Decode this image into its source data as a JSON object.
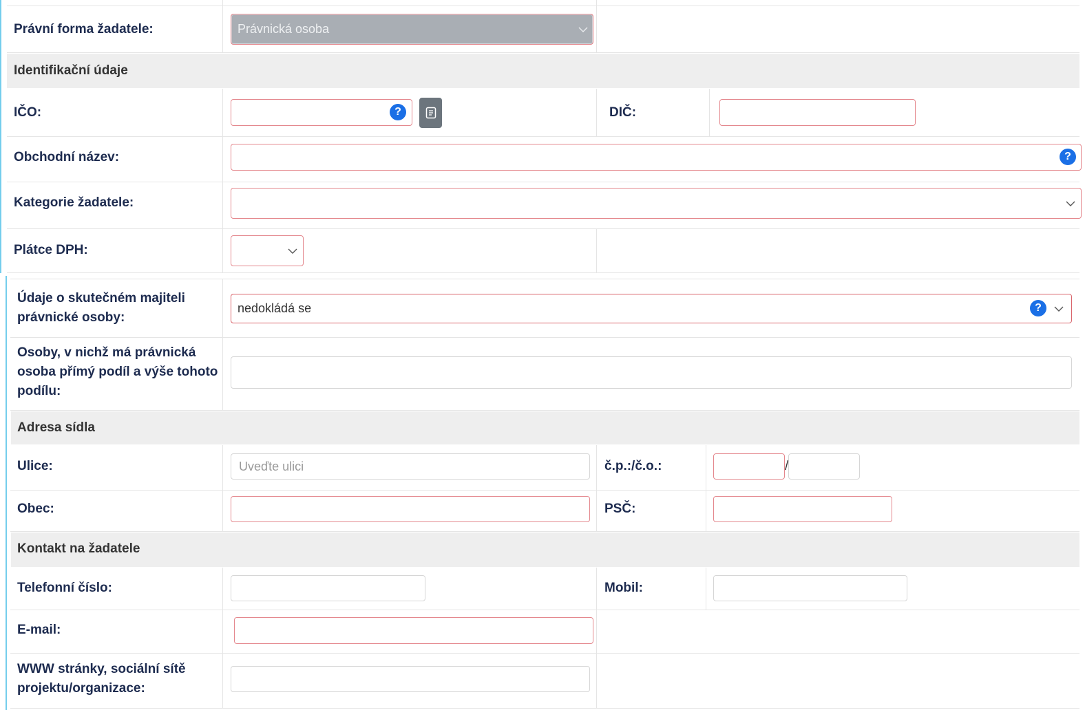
{
  "legal_form": {
    "label": "Právní forma žadatele:",
    "value": "Právnická osoba"
  },
  "identification": {
    "heading": "Identifikační údaje",
    "ico": {
      "label": "IČO:",
      "value": ""
    },
    "dic": {
      "label": "DIČ:",
      "value": ""
    },
    "business_name": {
      "label": "Obchodní název:",
      "value": ""
    },
    "category": {
      "label": "Kategorie žadatele:",
      "value": ""
    },
    "vat_payer": {
      "label": "Plátce DPH:",
      "value": ""
    }
  },
  "ownership": {
    "beneficial_owner": {
      "label_lines": [
        "Údaje o skutečném majiteli",
        "právnické osoby:"
      ],
      "value": "nedokládá se"
    },
    "direct_shares": {
      "label_lines": [
        "Osoby, v nichž má právnická",
        "osoba přímý podíl a výše tohoto",
        "podílu:"
      ],
      "value": ""
    }
  },
  "address": {
    "heading": "Adresa sídla",
    "street": {
      "label": "Ulice:",
      "value": "",
      "placeholder": "Uveďte ulici"
    },
    "house_number": {
      "label": "č.p.:/č.o.:",
      "cp_value": "",
      "separator": "/",
      "co_value": ""
    },
    "city": {
      "label": "Obec:",
      "value": ""
    },
    "postal_code": {
      "label": "PSČ:",
      "value": ""
    }
  },
  "contact": {
    "heading": "Kontakt na žadatele",
    "phone": {
      "label": "Telefonní číslo:",
      "value": ""
    },
    "mobile": {
      "label": "Mobil:",
      "value": ""
    },
    "email": {
      "label": "E-mail:",
      "value": ""
    },
    "website": {
      "label_lines": [
        "WWW stránky, sociální sítě",
        "projektu/organizace:"
      ],
      "value": ""
    }
  },
  "ui": {
    "help_glyph": "?",
    "icons": {
      "help": "help-icon",
      "dropdown": "chevron-down-icon",
      "lookup": "document-icon"
    }
  },
  "colors": {
    "label": "#1d2b4f",
    "heading": "#333333",
    "header_bg": "#eeeeee",
    "required_border": "#e4878d",
    "required_border_strong": "#d9636a",
    "help_blue": "#1a6fe6",
    "button_gray": "#6c757d",
    "accent_left": "#74cdec",
    "disabled_bg": "#a9aeb4"
  }
}
